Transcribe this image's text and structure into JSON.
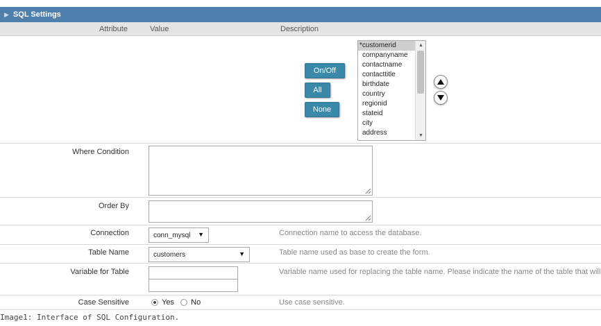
{
  "panel": {
    "title": "SQL Settings"
  },
  "columns": {
    "attribute": "Attribute",
    "value": "Value",
    "description": "Description"
  },
  "field_buttons": {
    "onoff": "On/Off",
    "all": "All",
    "none": "None"
  },
  "fields": {
    "items": [
      "*customerid",
      "companyname",
      "contactname",
      "contacttitle",
      "birthdate",
      "country",
      "regionid",
      "stateid",
      "city",
      "address"
    ],
    "selected": "*customerid"
  },
  "where_condition": {
    "label": "Where Condition",
    "value": ""
  },
  "order_by": {
    "label": "Order By",
    "value": ""
  },
  "connection": {
    "label": "Connection",
    "value": "conn_mysql",
    "description": "Connection name to access the database."
  },
  "table_name": {
    "label": "Table Name",
    "value": "customers",
    "description": "Table name used as base to create the form."
  },
  "variable_for_table": {
    "label": "Variable for Table",
    "description": "Variable name used for replacing the table name. Please indicate the name of the table that will b"
  },
  "case_sensitive": {
    "label": "Case Sensitive",
    "yes": "Yes",
    "no": "No",
    "selected": "Yes",
    "description": "Use case sensitive."
  },
  "caption": "Image1: Interface of SQL Configuration."
}
